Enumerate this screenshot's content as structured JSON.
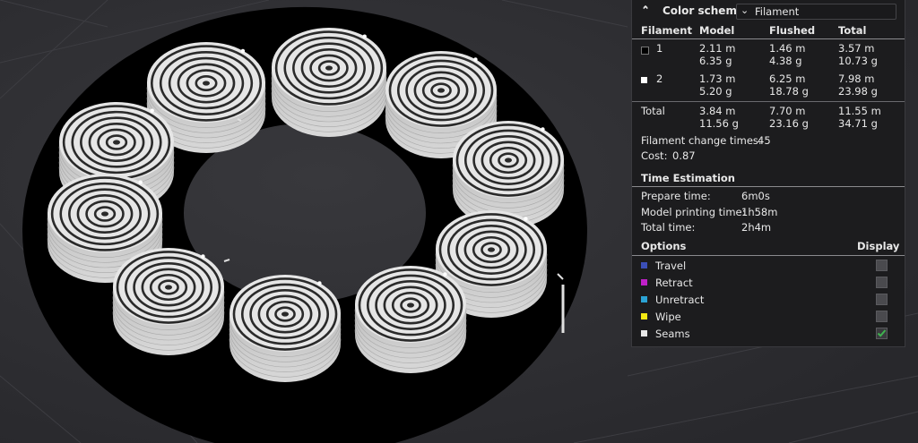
{
  "header": {
    "title": "Color scheme",
    "selected": "Filament"
  },
  "filament_table": {
    "headers": [
      "Filament",
      "Model",
      "Flushed",
      "Total"
    ],
    "rows": [
      {
        "label": "1",
        "color": "#000000",
        "model": [
          "2.11 m",
          "6.35 g"
        ],
        "flushed": [
          "1.46 m",
          "4.38 g"
        ],
        "total": [
          "3.57 m",
          "10.73 g"
        ]
      },
      {
        "label": "2",
        "color": "#ffffff",
        "model": [
          "1.73 m",
          "5.20 g"
        ],
        "flushed": [
          "6.25 m",
          "18.78 g"
        ],
        "total": [
          "7.98 m",
          "23.98 g"
        ]
      }
    ],
    "total_row": {
      "label": "Total",
      "model": [
        "3.84 m",
        "11.56 g"
      ],
      "flushed": [
        "7.70 m",
        "23.16 g"
      ],
      "total": [
        "11.55 m",
        "34.71 g"
      ]
    }
  },
  "summary": {
    "change_label": "Filament change times:",
    "change_value": "45",
    "cost_label": "Cost:",
    "cost_value": "0.87"
  },
  "time": {
    "title": "Time Estimation",
    "rows": [
      {
        "label": "Prepare time:",
        "value": "6m0s"
      },
      {
        "label": "Model printing time:",
        "value": "1h58m"
      },
      {
        "label": "Total time:",
        "value": "2h4m"
      }
    ]
  },
  "options": {
    "title": "Options",
    "display_label": "Display",
    "items": [
      {
        "label": "Travel",
        "color": "#3b4fb8",
        "checked": false
      },
      {
        "label": "Retract",
        "color": "#c020c8",
        "checked": false
      },
      {
        "label": "Unretract",
        "color": "#2ba3d4",
        "checked": false
      },
      {
        "label": "Wipe",
        "color": "#f2e813",
        "checked": false
      },
      {
        "label": "Seams",
        "color": "#e8e8e8",
        "checked": true
      }
    ]
  },
  "icons": {
    "collapse": "chevron-up-double-icon",
    "dropdown": "chevron-down-icon",
    "check": "check-icon"
  },
  "colors": {
    "background": "#2d2d31",
    "panel": "#1c1c1e",
    "ring": "#000000",
    "filament_white": "#e6e6e6",
    "check_green": "#3fb34f"
  }
}
